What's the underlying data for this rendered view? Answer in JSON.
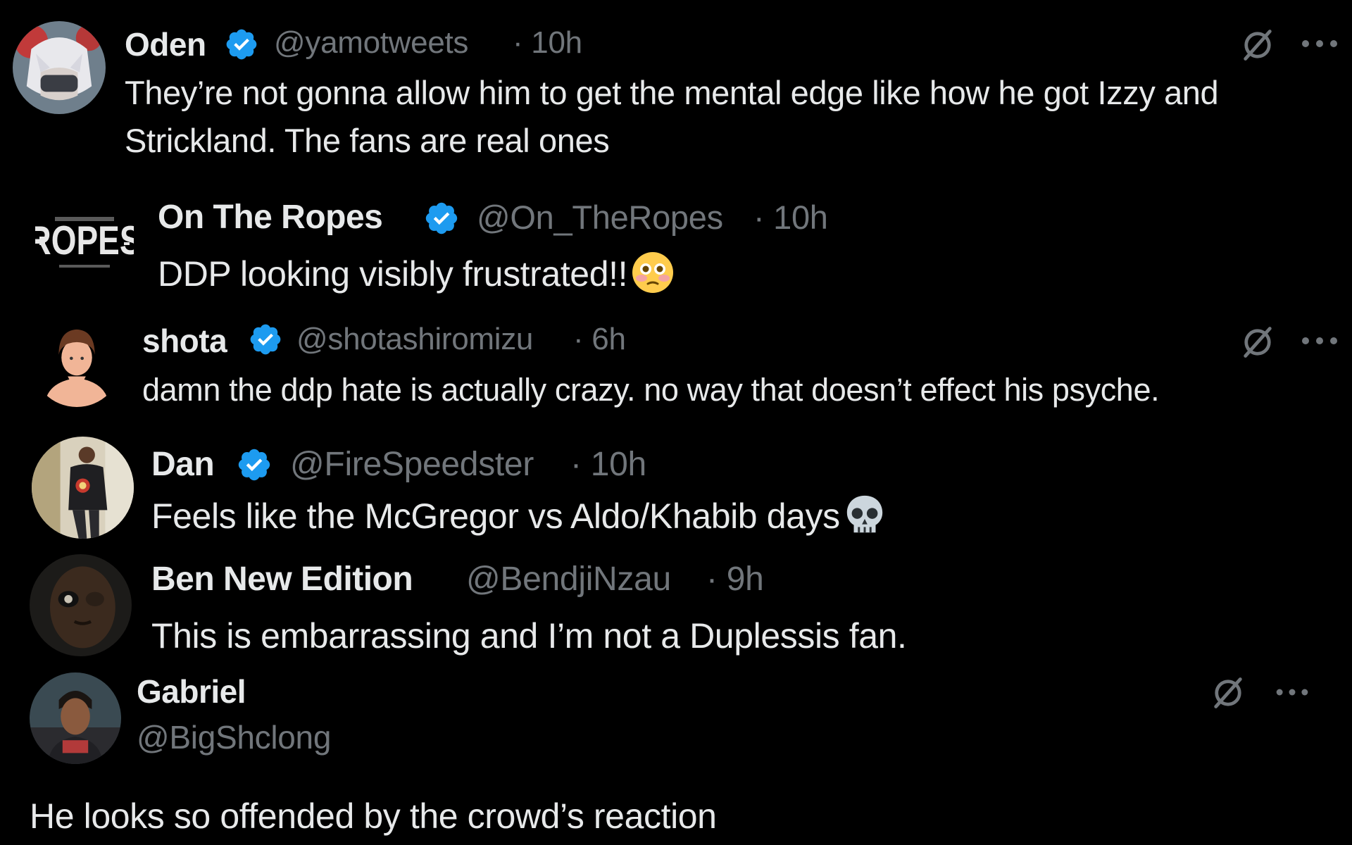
{
  "tweets": [
    {
      "name": "Oden",
      "verified": true,
      "handle": "@yamotweets",
      "time": "· 10h",
      "text_line1": "They’re not gonna allow him to get the mental edge like how he got Izzy and",
      "text_line2": "Strickland. The fans are real ones",
      "avatar_icon": "anime-avatar",
      "has_grok": true,
      "has_more": true
    },
    {
      "name": "On The Ropes",
      "verified": true,
      "handle": "@On_TheRopes",
      "time": "· 10h",
      "text": "DDP looking visibly frustrated!!",
      "emoji": "flushed-face-emoji",
      "avatar_icon": "on-the-ropes-logo",
      "logo_text": "ROPES"
    },
    {
      "name": "shota",
      "verified": true,
      "handle": "@shotashiromizu",
      "time": "· 6h",
      "text": "damn the ddp hate is actually crazy. no way that doesn’t effect his psyche.",
      "avatar_icon": "cartoon-person-avatar",
      "has_grok": true,
      "has_more": true
    },
    {
      "name": "Dan",
      "verified": true,
      "handle": "@FireSpeedster",
      "time": "· 10h",
      "text": "Feels like the McGregor vs Aldo/Khabib days",
      "emoji": "skull-emoji",
      "avatar_icon": "photo-avatar"
    },
    {
      "name": "Ben New Edition",
      "verified": false,
      "handle": "@BendjiNzau",
      "time": "· 9h",
      "text": "This is embarrassing and I’m not a Duplessis fan.",
      "avatar_icon": "face-photo-avatar"
    },
    {
      "name": "Gabriel",
      "verified": false,
      "handle": "@BigShclong",
      "text": "He looks so offended by the crowd’s reaction",
      "avatar_icon": "photo-avatar",
      "has_grok": true,
      "has_more": true
    }
  ],
  "colors": {
    "background": "#000000",
    "text": "#e7e9ea",
    "secondary": "#71767b",
    "verified": "#1d9bf0"
  }
}
